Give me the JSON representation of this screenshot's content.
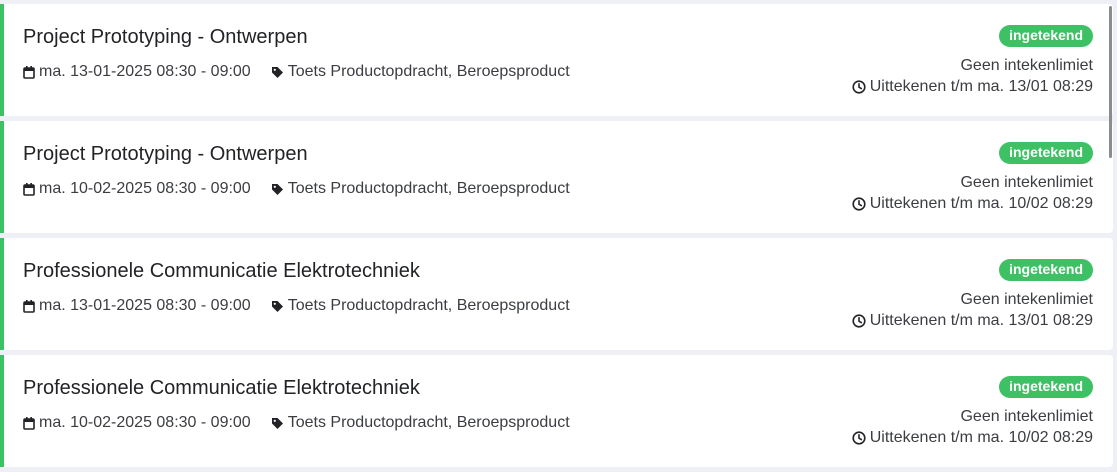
{
  "events": [
    {
      "title": "Project Prototyping - Ontwerpen",
      "datetime": "ma. 13-01-2025 08:30 - 09:00",
      "tags": "Toets Productopdracht, Beroepsproduct",
      "status": "ingetekend",
      "limit": "Geen intekenlimiet",
      "deadline": "Uittekenen t/m ma. 13/01 08:29"
    },
    {
      "title": "Project Prototyping - Ontwerpen",
      "datetime": "ma. 10-02-2025 08:30 - 09:00",
      "tags": "Toets Productopdracht, Beroepsproduct",
      "status": "ingetekend",
      "limit": "Geen intekenlimiet",
      "deadline": "Uittekenen t/m ma. 10/02 08:29"
    },
    {
      "title": "Professionele Communicatie Elektrotechniek",
      "datetime": "ma. 13-01-2025 08:30 - 09:00",
      "tags": "Toets Productopdracht, Beroepsproduct",
      "status": "ingetekend",
      "limit": "Geen intekenlimiet",
      "deadline": "Uittekenen t/m ma. 13/01 08:29"
    },
    {
      "title": "Professionele Communicatie Elektrotechniek",
      "datetime": "ma. 10-02-2025 08:30 - 09:00",
      "tags": "Toets Productopdracht, Beroepsproduct",
      "status": "ingetekend",
      "limit": "Geen intekenlimiet",
      "deadline": "Uittekenen t/m ma. 10/02 08:29"
    }
  ],
  "icons": {
    "date": "calendar-icon",
    "tags": "tag-icon",
    "deadline": "clock-icon"
  },
  "colors": {
    "accent": "#3ec164",
    "badge_text": "#ffffff",
    "text": "#3b3d42",
    "title": "#222326",
    "background": "#eef0f6"
  }
}
